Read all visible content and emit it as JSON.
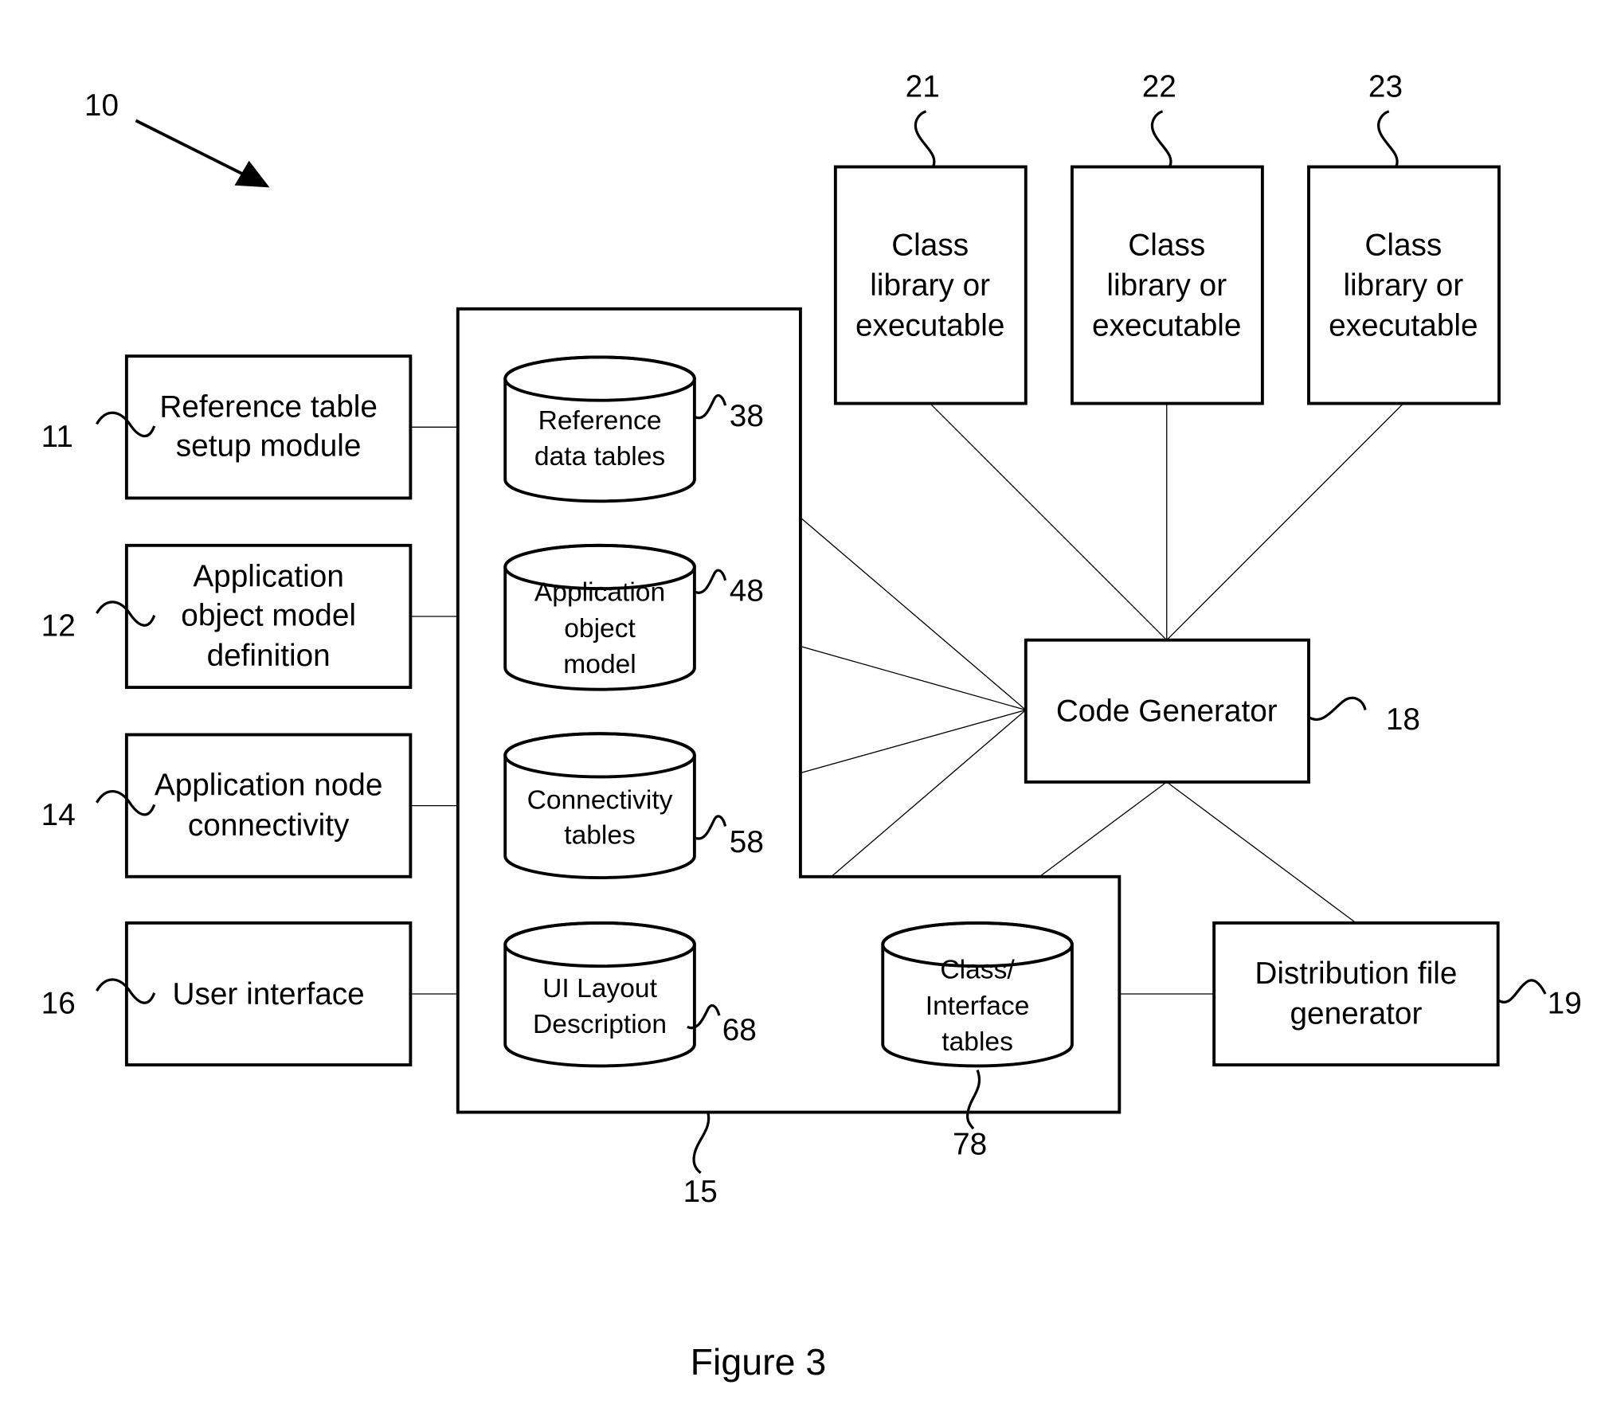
{
  "figure": {
    "caption": "Figure 3",
    "system_ref": "10"
  },
  "modules": [
    {
      "id": "reference-table-setup",
      "ref": "11",
      "lines": [
        "Reference table",
        "setup module"
      ]
    },
    {
      "id": "application-object-model-definition",
      "ref": "12",
      "lines": [
        "Application",
        "object model",
        "definition"
      ]
    },
    {
      "id": "application-node-connectivity",
      "ref": "14",
      "lines": [
        "Application node",
        "connectivity"
      ]
    },
    {
      "id": "user-interface",
      "ref": "16",
      "lines": [
        "User interface"
      ]
    }
  ],
  "storage": {
    "ref": "15",
    "tables": [
      {
        "id": "reference-data-tables",
        "ref": "38",
        "lines": [
          "Reference",
          "data tables"
        ]
      },
      {
        "id": "application-object-model",
        "ref": "48",
        "lines": [
          "Application",
          "object",
          "model"
        ]
      },
      {
        "id": "connectivity-tables",
        "ref": "58",
        "lines": [
          "Connectivity",
          "tables"
        ]
      },
      {
        "id": "ui-layout-description",
        "ref": "68",
        "lines": [
          "UI Layout",
          "Description"
        ]
      },
      {
        "id": "class-interface-tables",
        "ref": "78",
        "lines": [
          "Class/",
          "Interface",
          "tables"
        ]
      }
    ]
  },
  "code_generator": {
    "ref": "18",
    "label": "Code Generator"
  },
  "distribution": {
    "ref": "19",
    "lines": [
      "Distribution file",
      "generator"
    ]
  },
  "libraries": [
    {
      "ref": "21",
      "lines": [
        "Class",
        "library or",
        "executable"
      ]
    },
    {
      "ref": "22",
      "lines": [
        "Class",
        "library or",
        "executable"
      ]
    },
    {
      "ref": "23",
      "lines": [
        "Class",
        "library or",
        "executable"
      ]
    }
  ]
}
